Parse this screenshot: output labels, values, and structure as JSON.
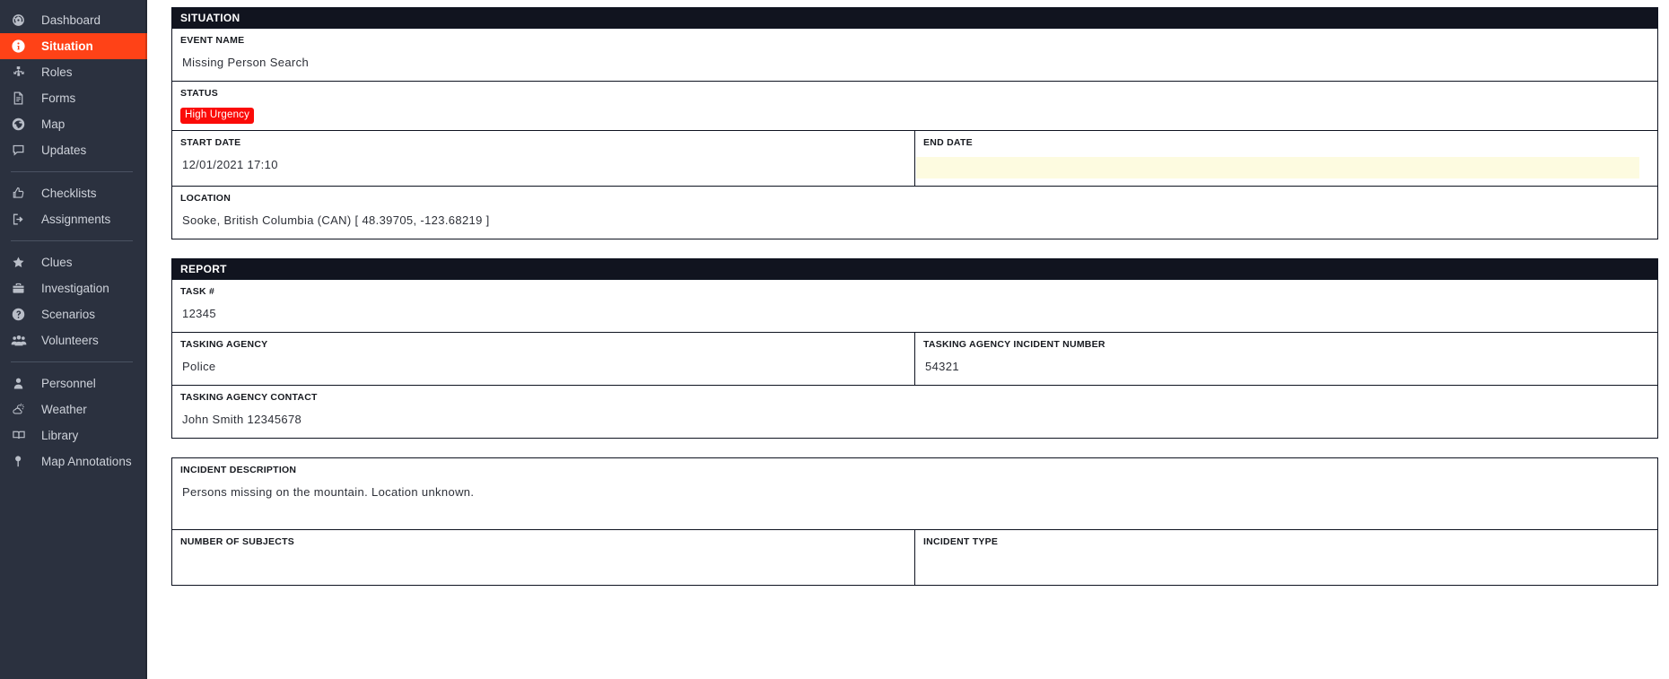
{
  "sidebar": {
    "groups": [
      {
        "items": [
          {
            "label": "Dashboard",
            "icon": "dashboard-icon",
            "active": false
          },
          {
            "label": "Situation",
            "icon": "info-circle-icon",
            "active": true
          },
          {
            "label": "Roles",
            "icon": "org-chart-icon",
            "active": false
          },
          {
            "label": "Forms",
            "icon": "document-icon",
            "active": false
          },
          {
            "label": "Map",
            "icon": "globe-icon",
            "active": false
          },
          {
            "label": "Updates",
            "icon": "chat-bubble-icon",
            "active": false
          }
        ]
      },
      {
        "items": [
          {
            "label": "Checklists",
            "icon": "thumbs-up-icon",
            "active": false
          },
          {
            "label": "Assignments",
            "icon": "sign-out-icon",
            "active": false
          }
        ]
      },
      {
        "items": [
          {
            "label": "Clues",
            "icon": "star-icon",
            "active": false
          },
          {
            "label": "Investigation",
            "icon": "briefcase-icon",
            "active": false
          },
          {
            "label": "Scenarios",
            "icon": "question-circle-icon",
            "active": false
          },
          {
            "label": "Volunteers",
            "icon": "people-group-icon",
            "active": false
          }
        ]
      },
      {
        "items": [
          {
            "label": "Personnel",
            "icon": "person-icon",
            "active": false
          },
          {
            "label": "Weather",
            "icon": "weather-cloud-sun-icon",
            "active": false
          },
          {
            "label": "Library",
            "icon": "book-open-icon",
            "active": false
          },
          {
            "label": "Map Annotations",
            "icon": "map-pin-icon",
            "active": false
          }
        ]
      }
    ]
  },
  "situation": {
    "header": "SITUATION",
    "event_name": {
      "label": "EVENT NAME",
      "value": "Missing Person Search"
    },
    "status": {
      "label": "STATUS",
      "badge": "High Urgency",
      "badge_color": "#fb0b08"
    },
    "start_date": {
      "label": "START DATE",
      "value": "12/01/2021 17:10"
    },
    "end_date": {
      "label": "END DATE",
      "value": "",
      "field_color": "#fdfbe0"
    },
    "location": {
      "label": "LOCATION",
      "value": "Sooke, British Columbia (CAN) [ 48.39705, -123.68219 ]"
    }
  },
  "report": {
    "header": "REPORT",
    "task_number": {
      "label": "TASK #",
      "value": "12345"
    },
    "tasking_agency": {
      "label": "TASKING AGENCY",
      "value": "Police"
    },
    "tasking_agency_incident_number": {
      "label": "TASKING AGENCY INCIDENT NUMBER",
      "value": "54321"
    },
    "tasking_agency_contact": {
      "label": "TASKING AGENCY CONTACT",
      "value": "John Smith 12345678"
    }
  },
  "incident": {
    "description": {
      "label": "INCIDENT DESCRIPTION",
      "value": "Persons missing on the mountain. Location unknown."
    },
    "number_of_subjects": {
      "label": "NUMBER OF SUBJECTS",
      "value": ""
    },
    "incident_type": {
      "label": "INCIDENT TYPE",
      "value": ""
    }
  }
}
